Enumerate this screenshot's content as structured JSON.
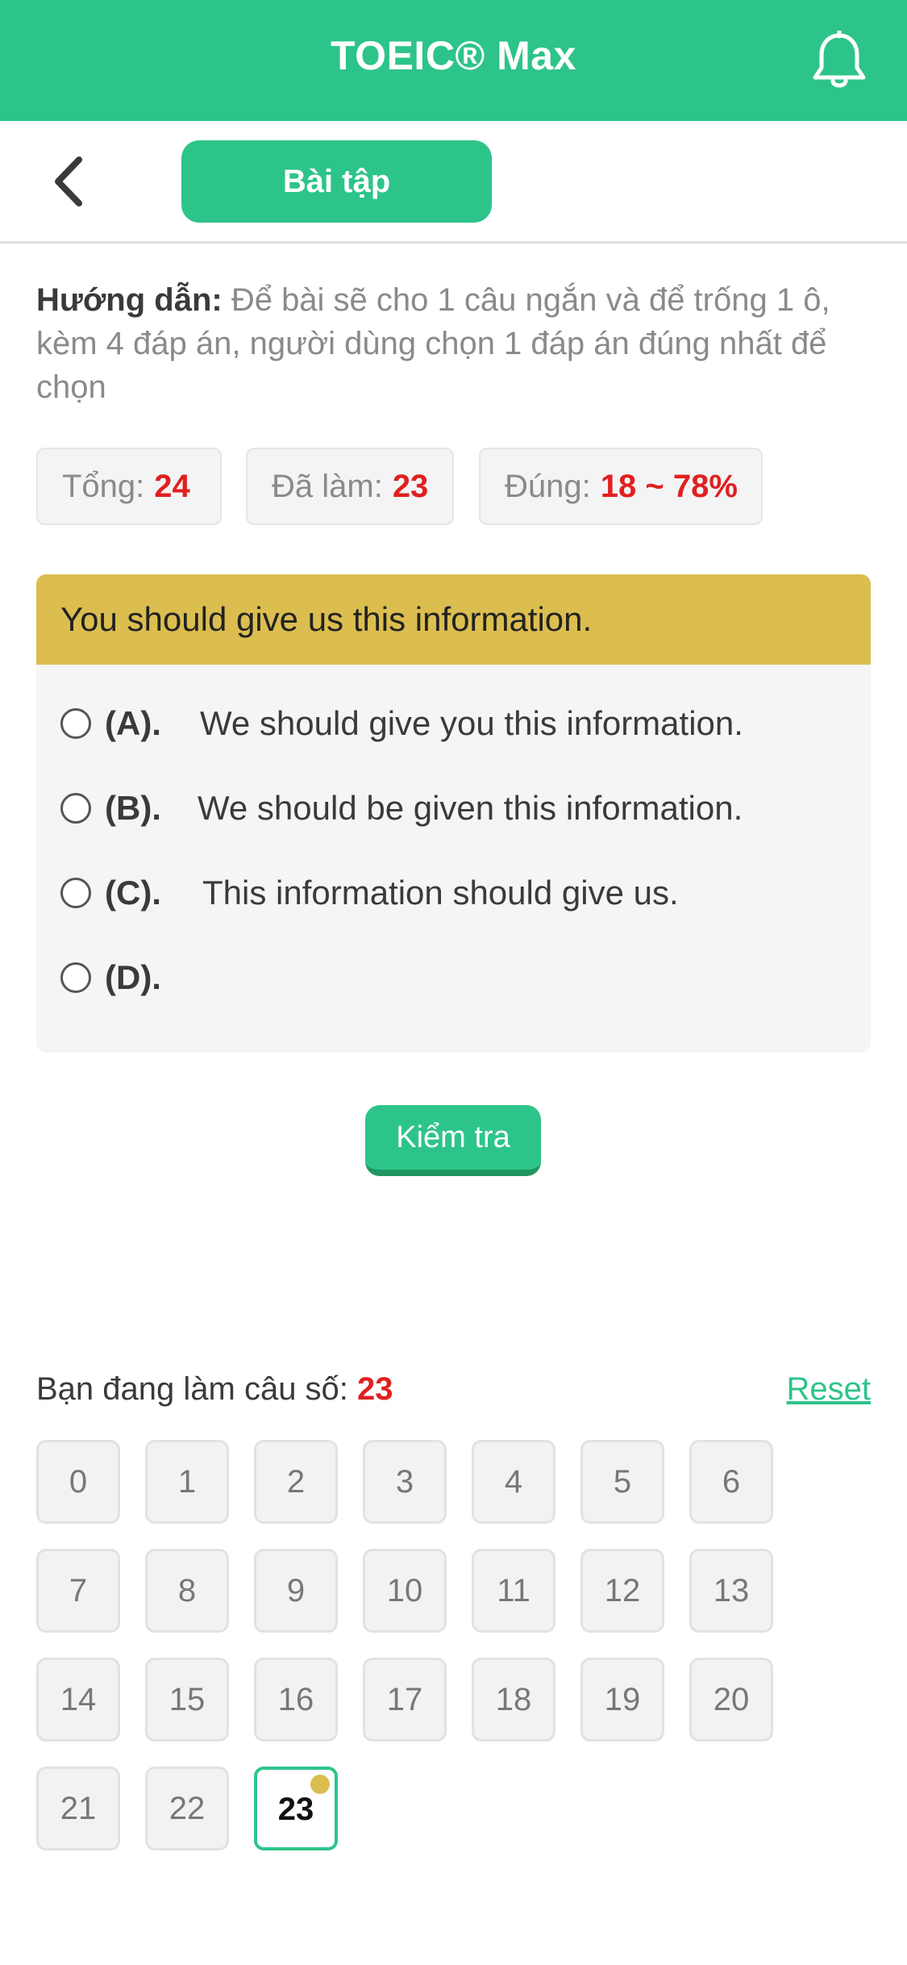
{
  "appbar": {
    "title": "TOEIC® Max"
  },
  "subbar": {
    "tab_label": "Bài tập"
  },
  "guide": {
    "label": "Hướng dẫn:",
    "text": " Để bài sẽ cho 1 câu ngắn và để trống 1 ô, kèm 4 đáp án, người dùng chọn 1 đáp án đúng nhất để chọn"
  },
  "stats": {
    "total_label": "Tổng:",
    "total_value": "24",
    "done_label": "Đã làm:",
    "done_value": "23",
    "correct_label": "Đúng:",
    "correct_value": "18 ~ 78%"
  },
  "question": {
    "text": "You should give us this information.",
    "options": [
      {
        "letter": "(A).",
        "text": "We should give you this information."
      },
      {
        "letter": "(B).",
        "text": "We should be given this information."
      },
      {
        "letter": "(C).",
        "text": "This information should give us."
      },
      {
        "letter": "(D).",
        "text": ""
      }
    ]
  },
  "check_button": "Kiểm tra",
  "progress": {
    "label": "Bạn đang làm câu số: ",
    "current": "23",
    "reset": "Reset"
  },
  "numbers": [
    "0",
    "1",
    "2",
    "3",
    "4",
    "5",
    "6",
    "7",
    "8",
    "9",
    "10",
    "11",
    "12",
    "13",
    "14",
    "15",
    "16",
    "17",
    "18",
    "19",
    "20",
    "21",
    "22",
    "23"
  ],
  "active_number": "23",
  "colors": {
    "primary": "#2dc48a",
    "question_header": "#dbbe4f",
    "highlight": "#e02020"
  }
}
